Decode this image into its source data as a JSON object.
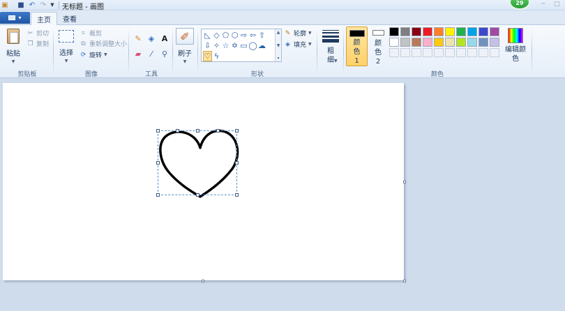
{
  "titlebar": {
    "title": "无标题 - 画图",
    "notification_count": "29",
    "icons": [
      "paint-app-icon",
      "save-icon",
      "undo-icon",
      "redo-icon",
      "customize-quick-access-icon"
    ]
  },
  "tabs": {
    "app_menu": "▤ ▾",
    "home": "主页",
    "view": "查看"
  },
  "ribbon": {
    "clipboard": {
      "label": "剪贴板",
      "paste": "粘贴",
      "cut": "剪切",
      "copy": "复制"
    },
    "image": {
      "label": "图像",
      "select": "选择",
      "crop": "裁剪",
      "resize": "重新调整大小",
      "rotate": "旋转"
    },
    "tools": {
      "label": "工具",
      "icons": [
        "pencil-icon",
        "fill-icon",
        "text-icon",
        "eraser-icon",
        "color-picker-icon",
        "magnifier-icon"
      ],
      "text_glyph": "A"
    },
    "brushes": {
      "label": "刷子"
    },
    "shapes": {
      "label": "形状",
      "outline": "轮廓",
      "fill": "填充",
      "selected": "heart"
    },
    "size": {
      "label": "粗细"
    },
    "colors": {
      "label": "颜色",
      "color1": "颜色 1",
      "color2": "颜色 2",
      "color1_value": "#000000",
      "color2_value": "#ffffff",
      "edit": "编辑颜色",
      "palette": [
        "#000000",
        "#7f7f7f",
        "#880015",
        "#ed1c24",
        "#ff7f27",
        "#fff200",
        "#22b14c",
        "#00a2e8",
        "#3f48cc",
        "#a349a4",
        "#ffffff",
        "#c3c3c3",
        "#b97a57",
        "#ffaec9",
        "#ffc90e",
        "#efe4b0",
        "#b5e61d",
        "#99d9ea",
        "#7092be",
        "#c8bfe7"
      ]
    }
  }
}
